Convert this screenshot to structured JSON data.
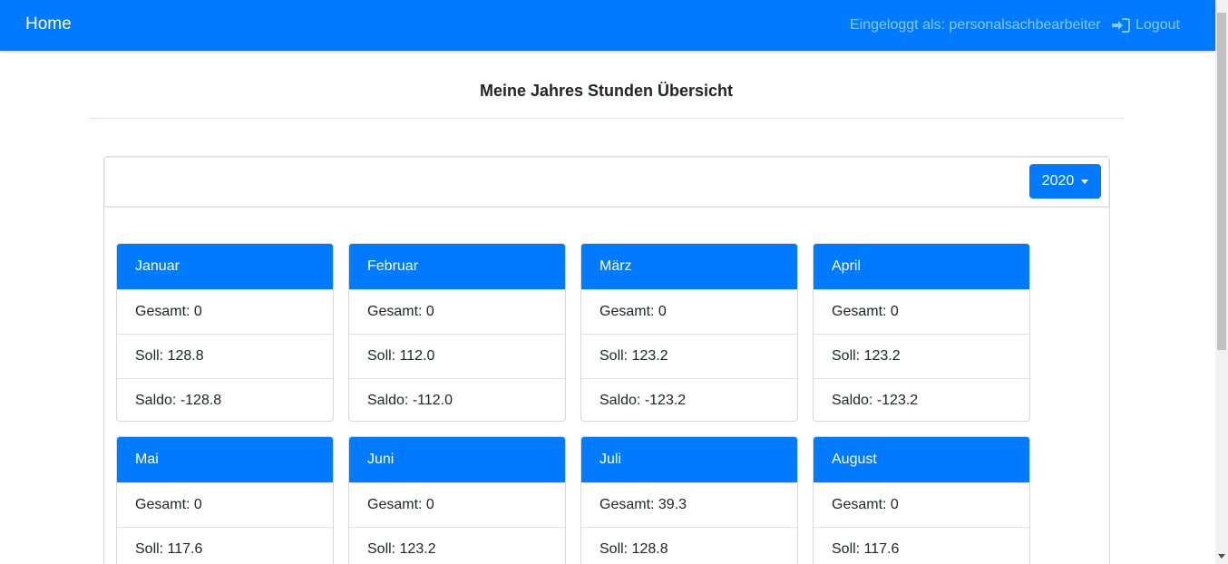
{
  "navbar": {
    "brand": "Home",
    "user_text": "Eingeloggt als: personalsachbearbeiter",
    "logout_label": "Logout"
  },
  "page": {
    "title": "Meine Jahres Stunden Übersicht"
  },
  "year_selector": {
    "value": "2020"
  },
  "months": [
    {
      "name": "Januar",
      "gesamt": "Gesamt: 0",
      "soll": "Soll: 128.8",
      "saldo": "Saldo: -128.8"
    },
    {
      "name": "Februar",
      "gesamt": "Gesamt: 0",
      "soll": "Soll: 112.0",
      "saldo": "Saldo: -112.0"
    },
    {
      "name": "März",
      "gesamt": "Gesamt: 0",
      "soll": "Soll: 123.2",
      "saldo": "Saldo: -123.2"
    },
    {
      "name": "April",
      "gesamt": "Gesamt: 0",
      "soll": "Soll: 123.2",
      "saldo": "Saldo: -123.2"
    },
    {
      "name": "Mai",
      "gesamt": "Gesamt: 0",
      "soll": "Soll: 117.6"
    },
    {
      "name": "Juni",
      "gesamt": "Gesamt: 0",
      "soll": "Soll: 123.2"
    },
    {
      "name": "Juli",
      "gesamt": "Gesamt: 39.3",
      "soll": "Soll: 128.8"
    },
    {
      "name": "August",
      "gesamt": "Gesamt: 0",
      "soll": "Soll: 117.6"
    }
  ],
  "colors": {
    "primary": "#007bff",
    "navbar_muted_text": "rgba(255,255,255,0.55)"
  }
}
